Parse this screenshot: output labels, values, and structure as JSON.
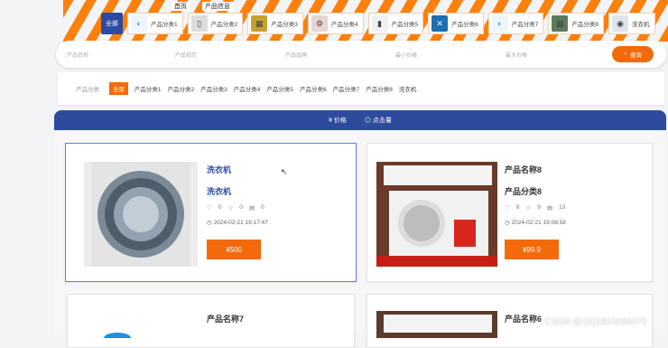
{
  "topnav": {
    "home": "首页",
    "product_info": "产品信息"
  },
  "categories": {
    "all": "全部",
    "items": [
      {
        "label": "产品分类1",
        "icon": "brand-icon",
        "color": "#eef6fb"
      },
      {
        "label": "产品分类2",
        "icon": "fridge-icon",
        "color": "#dcdcdc"
      },
      {
        "label": "产品分类3",
        "icon": "board-icon",
        "color": "#c7a12f"
      },
      {
        "label": "产品分类4",
        "icon": "appliance-icon",
        "color": "#e6d5d5"
      },
      {
        "label": "产品分类5",
        "icon": "phone-icon",
        "color": "#f0f0f0"
      },
      {
        "label": "产品分类6",
        "icon": "tools-icon",
        "color": "#1c6fb1"
      },
      {
        "label": "产品分类7",
        "icon": "brand-icon",
        "color": "#eef6fb"
      },
      {
        "label": "产品分类8",
        "icon": "board-icon",
        "color": "#5a7c5a"
      },
      {
        "label": "洗衣机",
        "icon": "washer-icon",
        "color": "#dfe5ea"
      }
    ]
  },
  "search": {
    "fields": [
      "产品名称",
      "产品规范",
      "产品品牌",
      "最小价格",
      "最大价格"
    ],
    "button": "查询"
  },
  "filter": {
    "label": "产品分类:",
    "options": [
      "全部",
      "产品分类1",
      "产品分类2",
      "产品分类3",
      "产品分类4",
      "产品分类5",
      "产品分类6",
      "产品分类7",
      "产品分类8",
      "洗衣机"
    ]
  },
  "sort": {
    "price": "¥ 价格",
    "clicks": "◎ 点击量"
  },
  "products": [
    {
      "name": "洗衣机",
      "category": "洗衣机",
      "likes": "0",
      "favorites": "0",
      "views": "0",
      "date": "2024-02-21 19:17:47",
      "price": "¥500",
      "image": "washer-image"
    },
    {
      "name": "产品名称8",
      "category": "产品分类8",
      "likes": "8",
      "favorites": "9",
      "views": "13",
      "date": "2024-02-21 19:08:58",
      "price": "¥99.9",
      "image": "air-conditioner-image"
    },
    {
      "name": "产品名称7",
      "image": "product-image"
    },
    {
      "name": "产品名称6",
      "image": "air-conditioner-image"
    }
  ],
  "watermark": "CSDN @QQ1963288475",
  "colors": {
    "accent": "#f26a0a",
    "nav": "#2d4b9c"
  }
}
